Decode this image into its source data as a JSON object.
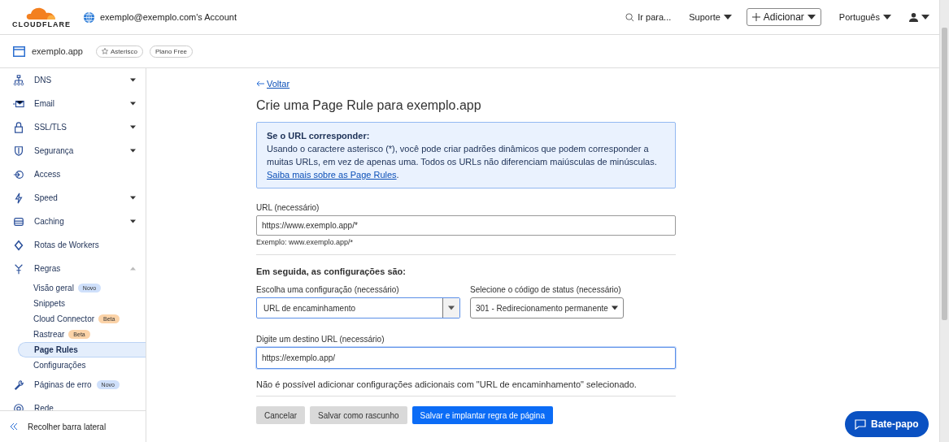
{
  "topbar": {
    "brand": "CLOUDFLARE",
    "account": "exemplo@exemplo.com's Account",
    "search": "Ir para...",
    "support": "Suporte",
    "add": "Adicionar",
    "language": "Português"
  },
  "zone": {
    "name": "exemplo.app",
    "tags": [
      {
        "text": "Asterisco",
        "starred": true
      },
      {
        "text": "Plano Free",
        "starred": false
      }
    ]
  },
  "sidebar": {
    "items": [
      {
        "label": "DNS",
        "kind": "menu",
        "expanded": false
      },
      {
        "label": "Email",
        "kind": "menu",
        "expanded": false
      },
      {
        "label": "SSL/TLS",
        "kind": "menu",
        "expanded": false
      },
      {
        "label": "Segurança",
        "kind": "menu",
        "expanded": false
      },
      {
        "label": "Access",
        "kind": "link"
      },
      {
        "label": "Speed",
        "kind": "menu",
        "expanded": false
      },
      {
        "label": "Caching",
        "kind": "menu",
        "expanded": false
      },
      {
        "label": "Rotas de Workers",
        "kind": "link"
      },
      {
        "label": "Regras",
        "kind": "menu",
        "expanded": true,
        "children": [
          {
            "label": "Visão geral",
            "selected": false,
            "badge": {
              "text": "Novo",
              "color": "#cfe0fb"
            }
          },
          {
            "label": "Snippets",
            "selected": false
          },
          {
            "label": "Cloud Connector",
            "selected": false,
            "badge": {
              "text": "Beta",
              "color": "#fbd3a8"
            }
          },
          {
            "label": "Rastrear",
            "selected": false,
            "badge": {
              "text": "Beta",
              "color": "#fbd3a8"
            }
          },
          {
            "label": "Page Rules",
            "selected": true
          },
          {
            "label": "Configurações",
            "selected": false
          }
        ]
      },
      {
        "label": "Páginas de erro",
        "kind": "link",
        "badge": {
          "text": "Novo",
          "color": "#cfe0fb"
        }
      },
      {
        "label": "Rede",
        "kind": "link"
      }
    ],
    "collapse": "Recolher barra lateral"
  },
  "main": {
    "back": "Voltar",
    "title": "Crie uma Page Rule para exemplo.app",
    "info": {
      "heading": "Se o URL corresponder:",
      "text": "Usando o caractere asterisco (*), você pode criar padrões dinâmicos que podem corresponder a muitas URLs, em vez de apenas uma. Todos os URLs não diferenciam maiúsculas de minúsculas.",
      "link": "Saiba mais sobre as Page Rules",
      "after": "."
    },
    "url": {
      "label": "URL (necessário)",
      "value": "https://www.exemplo.app/*",
      "focused": false,
      "hint": "Exemplo: www.exemplo.app/*"
    },
    "settings_heading": "Em seguida, as configurações são:",
    "setting": {
      "label": "Escolha uma configuração (necessário)",
      "value": "URL de encaminhamento",
      "focused": true
    },
    "status": {
      "label": "Selecione o código de status (necessário)",
      "value": "301 - Redirecionamento permanente",
      "focused": false
    },
    "destination": {
      "label": "Digite um destino URL (necessário)",
      "value": "https://exemplo.app/",
      "focused": true
    },
    "note": "Não é possível adicionar configurações adicionais com \"URL de encaminhamento\" selecionado.",
    "buttons": [
      {
        "label": "Cancelar",
        "kind": "secondary"
      },
      {
        "label": "Salvar como rascunho",
        "kind": "secondary"
      },
      {
        "label": "Salvar e implantar regra de página",
        "kind": "primary"
      }
    ]
  },
  "chat": "Bate-papo"
}
